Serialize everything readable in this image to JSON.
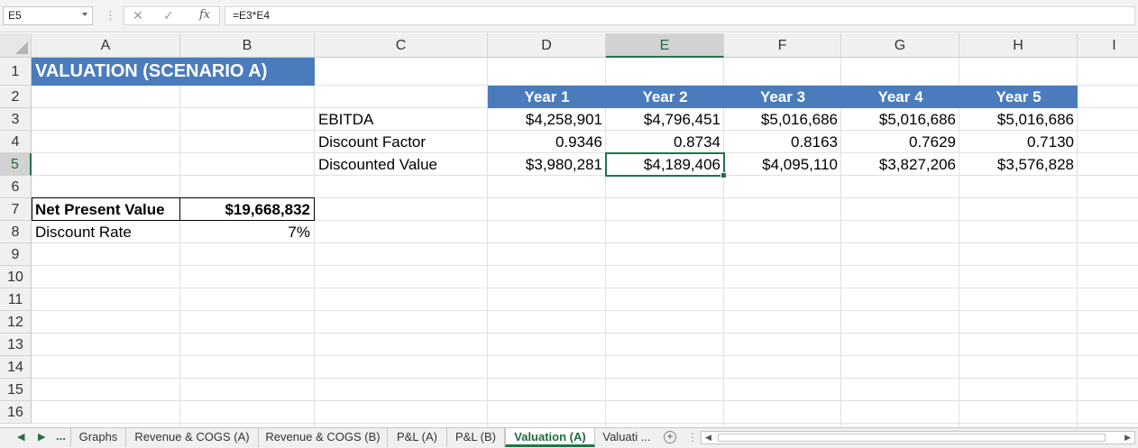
{
  "formula_bar": {
    "name_box": "E5",
    "separator": "⋮",
    "cancel_icon": "✕",
    "enter_icon": "✓",
    "fx_label": "fx",
    "formula": "=E3*E4"
  },
  "columns": [
    "A",
    "B",
    "C",
    "D",
    "E",
    "F",
    "G",
    "H",
    "I"
  ],
  "rows": [
    "1",
    "2",
    "3",
    "4",
    "5",
    "6",
    "7",
    "8",
    "9",
    "10",
    "11",
    "12",
    "13",
    "14",
    "15",
    "16"
  ],
  "selected": {
    "column": "E",
    "row": "5"
  },
  "sheet": {
    "title": "VALUATION (SCENARIO A)",
    "years": [
      "Year 1",
      "Year 2",
      "Year 3",
      "Year 4",
      "Year 5"
    ],
    "ebitda_label": "EBITDA",
    "ebitda": [
      "$4,258,901",
      "$4,796,451",
      "$5,016,686",
      "$5,016,686",
      "$5,016,686"
    ],
    "discount_factor_label": "Discount Factor",
    "discount_factor": [
      "0.9346",
      "0.8734",
      "0.8163",
      "0.7629",
      "0.7130"
    ],
    "discounted_value_label": "Discounted Value",
    "discounted_value": [
      "$3,980,281",
      "$4,189,406",
      "$4,095,110",
      "$3,827,206",
      "$3,576,828"
    ],
    "npv_label": "Net Present Value",
    "npv_value": "$19,668,832",
    "discount_rate_label": "Discount Rate",
    "discount_rate_value": "7%"
  },
  "tabs": {
    "ellipsis": "...",
    "items": [
      "Graphs",
      "Revenue & COGS (A)",
      "Revenue & COGS (B)",
      "P&L (A)",
      "P&L (B)",
      "Valuation (A)",
      "Valuati ..."
    ],
    "active_index": 5,
    "add_label": "+"
  },
  "colors": {
    "header_blue": "#4a7cbd",
    "excel_green": "#217346"
  }
}
